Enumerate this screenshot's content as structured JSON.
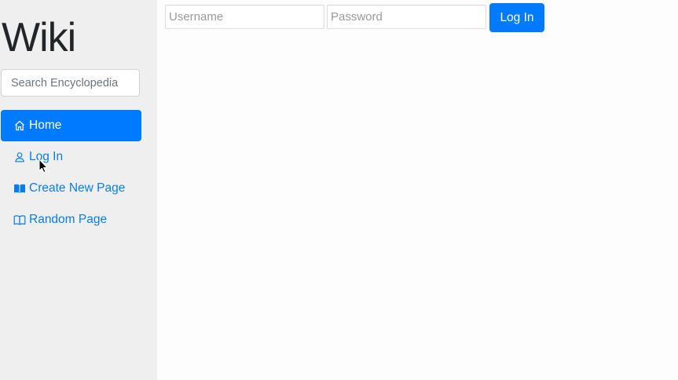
{
  "sidebar": {
    "title": "Wiki",
    "search": {
      "placeholder": "Search Encyclopedia"
    },
    "nav": [
      {
        "label": "Home",
        "icon": "house-icon",
        "active": true
      },
      {
        "label": "Log In",
        "icon": "person-icon",
        "active": false
      },
      {
        "label": "Create New Page",
        "icon": "book-filled-icon",
        "active": false
      },
      {
        "label": "Random Page",
        "icon": "book-open-icon",
        "active": false
      }
    ]
  },
  "login_form": {
    "username_placeholder": "Username",
    "password_placeholder": "Password",
    "submit_label": "Log In"
  },
  "colors": {
    "accent": "#007bff",
    "link": "#0a7ee6",
    "sidebar_bg": "#efefef"
  }
}
